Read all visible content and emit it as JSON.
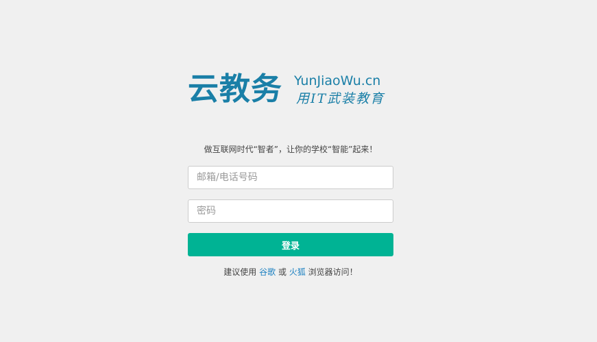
{
  "logo": {
    "chinese_name": "云教务",
    "domain": "YunJiaoWu.cn",
    "slogan": "用IT武装教育",
    "color": "#1a7fa7"
  },
  "tagline": "做互联网时代“智者”，让你的学校“智能”起来！",
  "form": {
    "email_placeholder": "邮箱/电话号码",
    "password_placeholder": "密码",
    "login_label": "登录",
    "login_color": "#00b394"
  },
  "browser_note": {
    "prefix": "建议使用",
    "chrome": "谷歌",
    "or": "或",
    "firefox": "火狐",
    "suffix": "浏览器访问！"
  }
}
